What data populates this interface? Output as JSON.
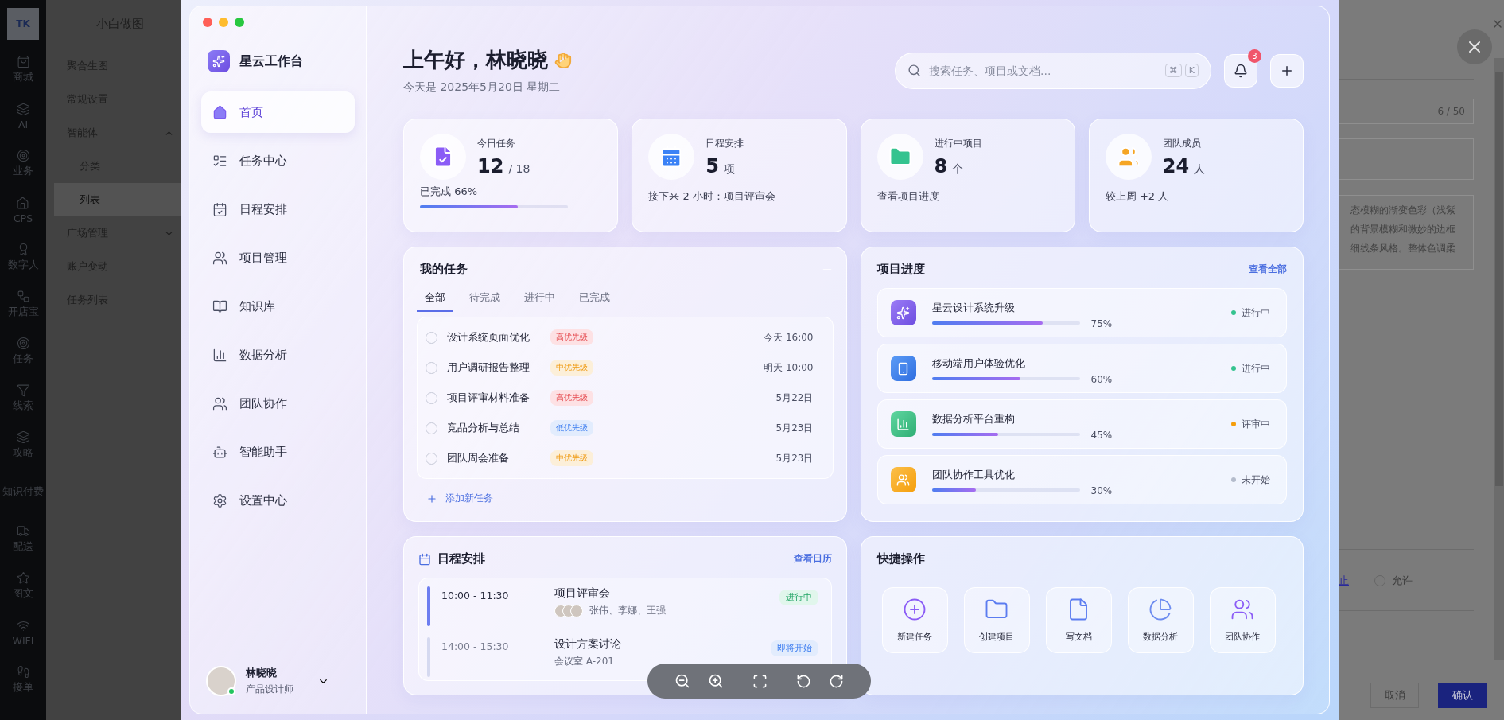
{
  "app_rail": {
    "logo": "TK",
    "items": [
      {
        "label": "商城"
      },
      {
        "label": "AI"
      },
      {
        "label": "业务"
      },
      {
        "label": "CPS"
      },
      {
        "label": "数字人"
      },
      {
        "label": "开店宝"
      },
      {
        "label": "任务"
      },
      {
        "label": "线索"
      },
      {
        "label": "攻略"
      },
      {
        "label": "知识付费"
      },
      {
        "label": "配送"
      },
      {
        "label": "图文"
      },
      {
        "label": "WIFI"
      },
      {
        "label": "接单"
      }
    ]
  },
  "nav": {
    "title": "小白做图",
    "items": [
      {
        "label": "聚合生图",
        "selected": false
      },
      {
        "label": "常规设置",
        "selected": false
      },
      {
        "label": "智能体",
        "selected": false,
        "expanded": true,
        "children": [
          {
            "label": "分类",
            "selected": false
          },
          {
            "label": "列表",
            "selected": true
          }
        ]
      },
      {
        "label": "广场管理",
        "selected": false,
        "expanded": false
      },
      {
        "label": "账户变动",
        "selected": false
      },
      {
        "label": "任务列表",
        "selected": false
      }
    ]
  },
  "dashboard": {
    "brand": "星云工作台",
    "menu": [
      {
        "label": "首页",
        "selected": true
      },
      {
        "label": "任务中心",
        "selected": false
      },
      {
        "label": "日程安排",
        "selected": false
      },
      {
        "label": "项目管理",
        "selected": false
      },
      {
        "label": "知识库",
        "selected": false
      },
      {
        "label": "数据分析",
        "selected": false
      },
      {
        "label": "团队协作",
        "selected": false
      },
      {
        "label": "智能助手",
        "selected": false
      },
      {
        "label": "设置中心",
        "selected": false
      }
    ],
    "user": {
      "name": "林晓晓",
      "role": "产品设计师",
      "online": true
    },
    "greeting": "上午好，林晓晓",
    "date": "今天是 2025年5月20日 星期二",
    "search": {
      "placeholder": "搜索任务、项目或文档...",
      "keys": [
        "⌘",
        "K"
      ]
    },
    "notifications": "3",
    "stats": [
      {
        "kind": "progress",
        "label": "今日任务",
        "value": "12",
        "unit": "/ 18",
        "note": "已完成 66%",
        "level": 0.66,
        "color": "#8b5cf6"
      },
      {
        "kind": "plain",
        "label": "日程安排",
        "value": "5",
        "unit": "项",
        "note": "接下来 2 小时：项目评审会",
        "color": "#3b82f6"
      },
      {
        "kind": "plain",
        "label": "进行中项目",
        "value": "8",
        "unit": "个",
        "note": "查看项目进度",
        "color": "#34c38f"
      },
      {
        "kind": "plain",
        "label": "团队成员",
        "value": "24",
        "unit": "人",
        "note": "较上周 +2 人",
        "color": "#f5a524"
      }
    ],
    "tasks": {
      "title": "我的任务",
      "tabs": [
        {
          "label": "全部",
          "selected": true
        },
        {
          "label": "待完成",
          "selected": false
        },
        {
          "label": "进行中",
          "selected": false
        },
        {
          "label": "已完成",
          "selected": false
        }
      ],
      "items": [
        {
          "title": "设计系统页面优化",
          "priority": "高优先级",
          "kind": "high",
          "due": "今天 16:00",
          "done": false
        },
        {
          "title": "用户调研报告整理",
          "priority": "中优先级",
          "kind": "medium",
          "due": "明天 10:00",
          "done": false
        },
        {
          "title": "项目评审材料准备",
          "priority": "高优先级",
          "kind": "high",
          "due": "5月22日",
          "done": false
        },
        {
          "title": "竞品分析与总结",
          "priority": "低优先级",
          "kind": "low",
          "due": "5月23日",
          "done": false
        },
        {
          "title": "团队周会准备",
          "priority": "中优先级",
          "kind": "medium",
          "due": "5月23日",
          "done": false
        }
      ],
      "add": "添加新任务"
    },
    "projects": {
      "title": "项目进度",
      "link": "查看全部",
      "items": [
        {
          "name": "星云设计系统升级",
          "level": 0.75,
          "percent": "75%",
          "status": "进行中",
          "color": "#34c38f"
        },
        {
          "name": "移动端用户体验优化",
          "level": 0.6,
          "percent": "60%",
          "status": "进行中",
          "color": "#34c38f"
        },
        {
          "name": "数据分析平台重构",
          "level": 0.45,
          "percent": "45%",
          "status": "评审中",
          "color": "#f59e0b"
        },
        {
          "name": "团队协作工具优化",
          "level": 0.3,
          "percent": "30%",
          "status": "未开始",
          "color": "#b4bccc"
        }
      ]
    },
    "schedule": {
      "title": "日程安排",
      "link": "查看日历",
      "events": [
        {
          "time": "10:00 - 11:30",
          "title": "项目评审会",
          "detail": "张伟、李娜、王强",
          "with_avatars": true,
          "status": "进行中",
          "active": true
        },
        {
          "time": "14:00 - 15:30",
          "title": "设计方案讨论",
          "detail": "会议室 A-201",
          "with_avatars": false,
          "status": "即将开始",
          "active": false
        }
      ]
    },
    "quick_actions": {
      "title": "快捷操作",
      "items": [
        {
          "label": "新建任务"
        },
        {
          "label": "创建项目"
        },
        {
          "label": "写文档"
        },
        {
          "label": "数据分析"
        },
        {
          "label": "团队协作"
        }
      ]
    }
  },
  "form": {
    "counter": "6 / 50",
    "description": [
      "态模糊的渐变色彩（浅紫",
      "的背景模糊和微妙的边框",
      "细线条风格。整体色调柔"
    ],
    "options": [
      {
        "label": "止",
        "selected": true
      },
      {
        "label": "允许",
        "selected": false
      }
    ],
    "buttons": [
      {
        "label": "取消",
        "kind": "secondary"
      },
      {
        "label": "确认",
        "kind": "primary"
      }
    ]
  }
}
